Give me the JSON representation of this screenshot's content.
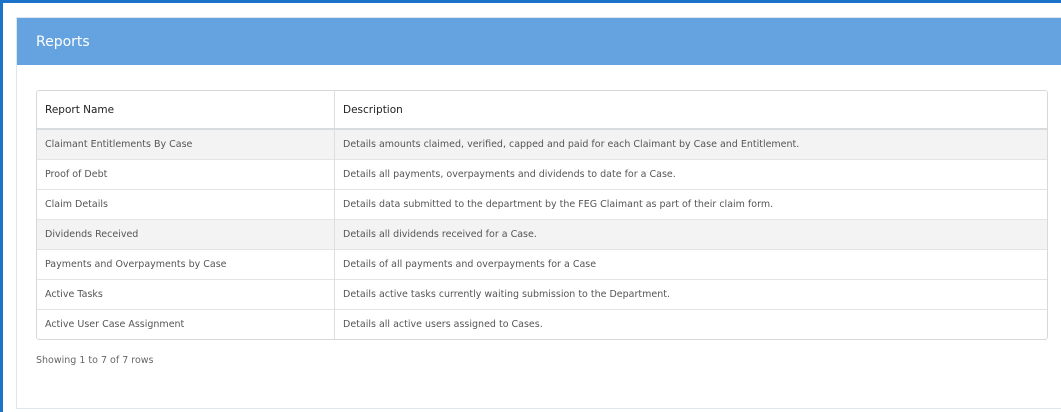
{
  "panel": {
    "title": "Reports"
  },
  "table": {
    "columns": [
      "Report Name",
      "Description"
    ],
    "rows": [
      {
        "name": "Claimant Entitlements By Case",
        "description": "Details amounts claimed, verified, capped and paid for each Claimant by Case and Entitlement."
      },
      {
        "name": "Proof of Debt",
        "description": "Details all payments, overpayments and dividends to date for a Case."
      },
      {
        "name": "Claim Details",
        "description": "Details data submitted to the department by the FEG Claimant as part of their claim form."
      },
      {
        "name": "Dividends Received",
        "description": "Details all dividends received for a Case."
      },
      {
        "name": "Payments and Overpayments by Case",
        "description": "Details of all payments and overpayments for a Case"
      },
      {
        "name": "Active Tasks",
        "description": "Details active tasks currently waiting submission to the Department."
      },
      {
        "name": "Active User Case Assignment",
        "description": "Details all active users assigned to Cases."
      }
    ]
  },
  "pagination": {
    "summary": "Showing 1 to 7 of 7 rows"
  },
  "colors": {
    "header_bg": "#64a3df",
    "frame_border": "#1a73c8",
    "row_alt": "#f3f3f3"
  }
}
